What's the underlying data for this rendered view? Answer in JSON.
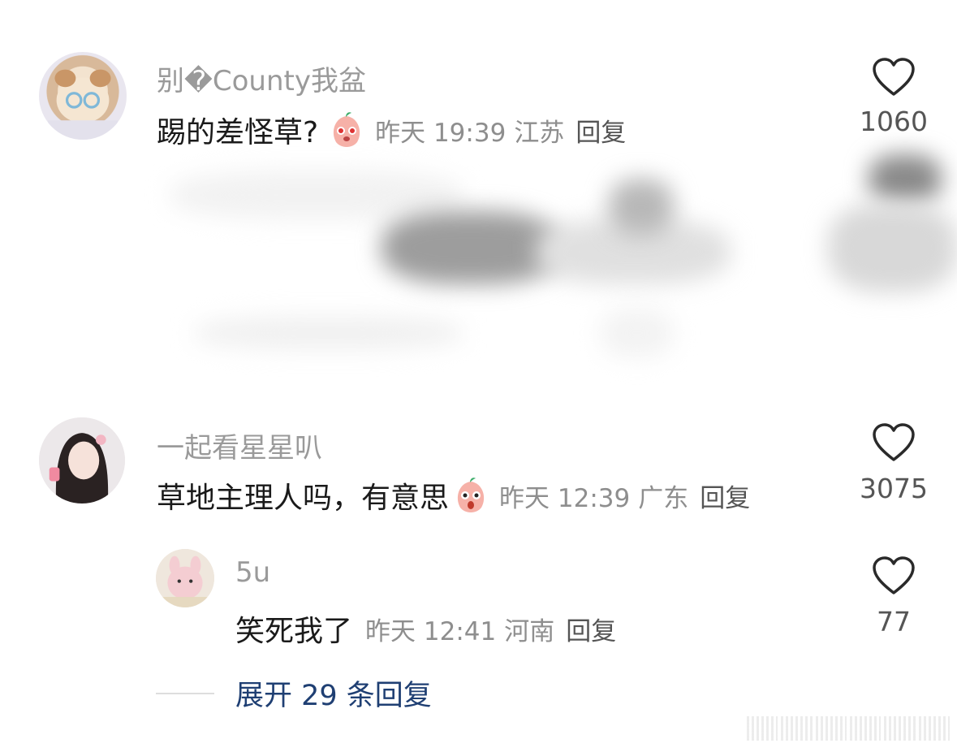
{
  "comments": [
    {
      "username": "别�County我盆",
      "text": "踢的差怪草?",
      "emoji": "blushing-peach-emoji",
      "time": "昨天 19:39",
      "location": "江苏",
      "reply": "回复",
      "likes": "1060"
    },
    {
      "username": "一起看星星叭",
      "text": "草地主理人吗，有意思",
      "emoji": "shocked-peach-emoji",
      "time": "昨天 12:39",
      "location": "广东",
      "reply": "回复",
      "likes": "3075"
    }
  ],
  "subreply": {
    "username": "5u",
    "text": "笑死我了",
    "time": "昨天 12:41",
    "location": "河南",
    "reply": "回复",
    "likes": "77"
  },
  "expand_label": "展开 29 条回复",
  "colors": {
    "accent_link": "#1f3f73",
    "meta": "#8e8e8e",
    "username": "#9a9a9a"
  }
}
